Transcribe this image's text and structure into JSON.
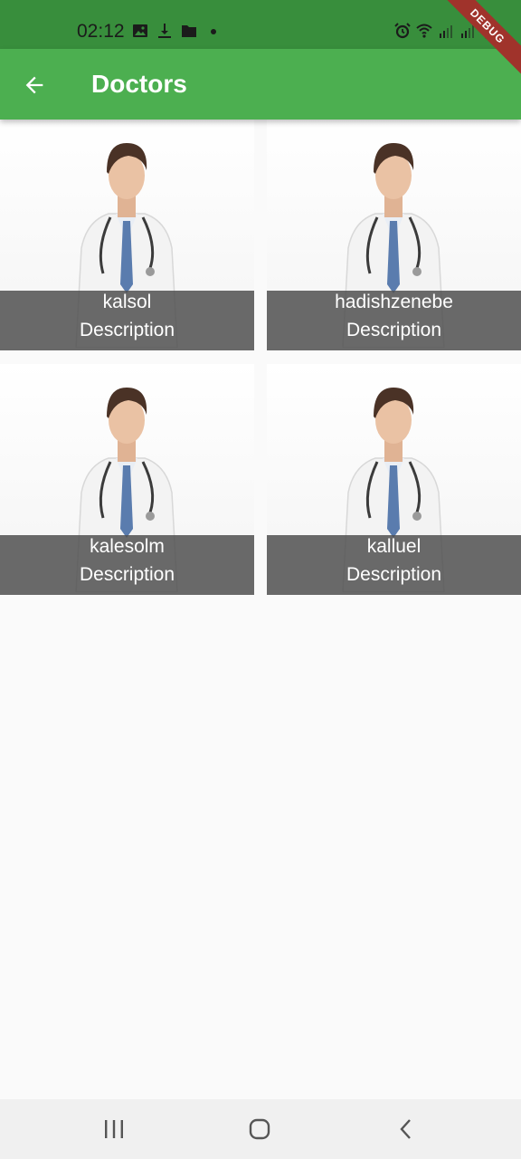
{
  "status_bar": {
    "time": "02:12",
    "left_icons": [
      "image-icon",
      "download-icon",
      "folder-icon",
      "dot-icon"
    ],
    "right_icons": [
      "alarm-icon",
      "wifi-icon",
      "signal-icon",
      "signal-icon",
      "battery-icon"
    ]
  },
  "debug_banner": "DEBUG",
  "app_bar": {
    "title": "Doctors",
    "back_icon": "arrow-back-icon"
  },
  "doctors": [
    {
      "name": "kalsol",
      "description": "Description"
    },
    {
      "name": "hadishzenebe",
      "description": "Description"
    },
    {
      "name": "kalesolm",
      "description": "Description"
    },
    {
      "name": "kalluel",
      "description": "Description"
    }
  ],
  "nav_bar": {
    "icons": [
      "recents-icon",
      "home-icon",
      "back-icon"
    ]
  },
  "colors": {
    "status_bar": "#388e3c",
    "app_bar": "#4caf50",
    "background": "#fafafa",
    "caption_overlay": "#505050"
  }
}
